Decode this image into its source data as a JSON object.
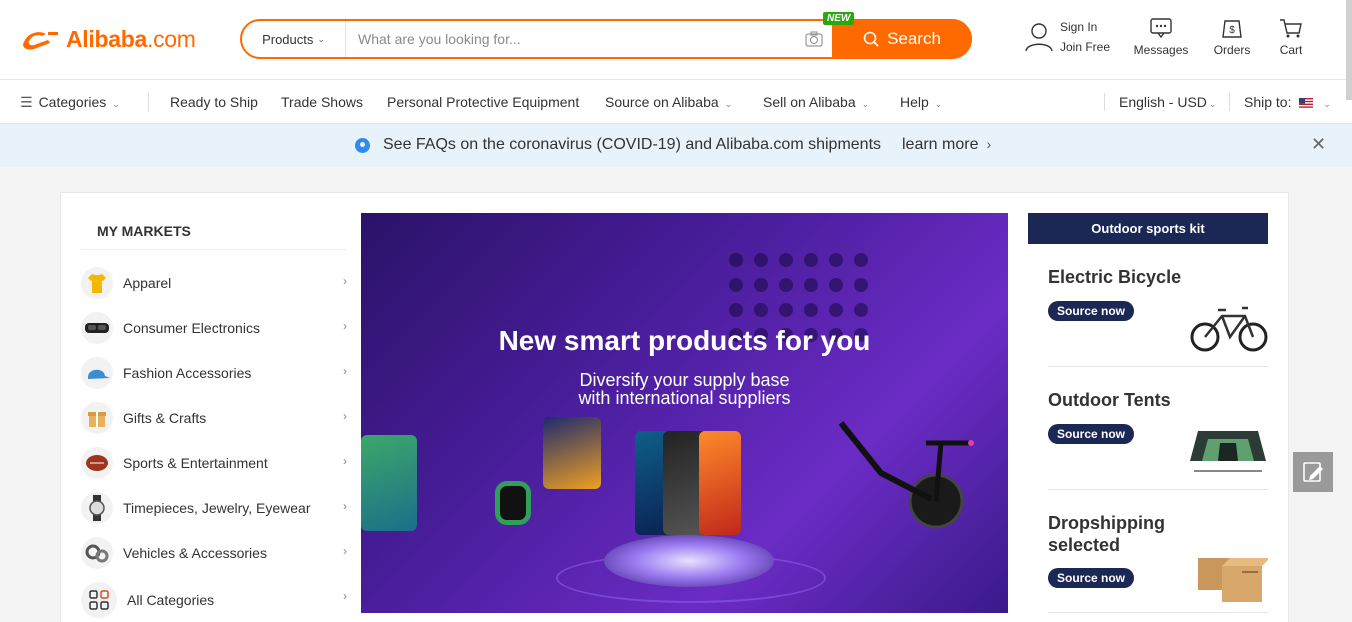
{
  "logo": {
    "brand": "Alibaba",
    "domain": ".com"
  },
  "search": {
    "category": "Products",
    "placeholder": "What are you looking for...",
    "button_label": "Search",
    "new_badge": "NEW"
  },
  "header_actions": {
    "sign_in": "Sign In",
    "join_free": "Join Free",
    "messages": "Messages",
    "orders": "Orders",
    "cart": "Cart"
  },
  "nav": {
    "categories": "Categories",
    "items": [
      "Ready to Ship",
      "Trade Shows",
      "Personal Protective Equipment",
      "Source on Alibaba",
      "Sell on Alibaba",
      "Help"
    ],
    "language": "English - USD",
    "ship_to": "Ship to:"
  },
  "notice": {
    "text": "See FAQs on the coronavirus (COVID-19) and Alibaba.com shipments",
    "link": "learn more"
  },
  "markets": {
    "title": "MY MARKETS",
    "items": [
      {
        "label": "Apparel",
        "icon": "shirt-icon"
      },
      {
        "label": "Consumer Electronics",
        "icon": "vr-headset-icon"
      },
      {
        "label": "Fashion Accessories",
        "icon": "cap-icon"
      },
      {
        "label": "Gifts & Crafts",
        "icon": "gift-icon"
      },
      {
        "label": "Sports & Entertainment",
        "icon": "ball-icon"
      },
      {
        "label": "Timepieces, Jewelry, Eyewear",
        "icon": "watch-icon"
      },
      {
        "label": "Vehicles & Accessories",
        "icon": "gears-icon"
      },
      {
        "label": "All Categories",
        "icon": "grid-icon"
      }
    ]
  },
  "hero": {
    "headline": "New smart products for you",
    "subline1": "Diversify your supply base",
    "subline2": "with international suppliers"
  },
  "side": {
    "tag": "Outdoor sports kit",
    "products": [
      {
        "name": "Electric Bicycle",
        "button": "Source now"
      },
      {
        "name": "Outdoor Tents",
        "button": "Source now"
      },
      {
        "name": "Dropshipping selected",
        "button": "Source now"
      }
    ]
  },
  "colors": {
    "brand_orange": "#ff6a00",
    "navy": "#1b2856",
    "notice_bg": "#e7f2fa"
  }
}
